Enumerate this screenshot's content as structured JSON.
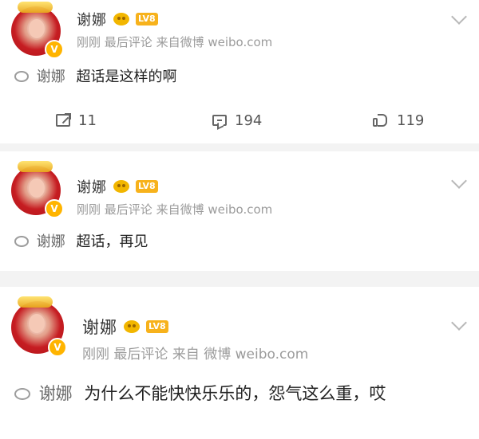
{
  "feed": {
    "posts": [
      {
        "username": "谢娜",
        "level": "LV8",
        "time": "刚刚",
        "last_comment": "最后评论",
        "source": "来自微博 weibo.com",
        "topic": "谢娜",
        "text": "超话是这样的啊",
        "repost_count": "11",
        "comment_count": "194",
        "like_count": "119"
      },
      {
        "username": "谢娜",
        "level": "LV8",
        "time": "刚刚",
        "last_comment": "最后评论",
        "source": "来自微博 weibo.com",
        "topic": "谢娜",
        "text": "超话，再见"
      },
      {
        "username": "谢娜",
        "level": "LV8",
        "time": "刚刚",
        "last_comment": "最后评论",
        "source": "来自 微博 weibo.com",
        "topic": "谢娜",
        "text": "为什么不能快快乐乐的，怨气这么重，哎"
      }
    ]
  },
  "icons": {
    "verified": "verified-badge-icon",
    "emoji": "emoji-badge-icon",
    "level": "level-badge-icon",
    "topic": "topic-icon",
    "menu": "chevron-down-icon",
    "repost": "repost-icon",
    "comment": "comment-icon",
    "like": "like-icon"
  },
  "colors": {
    "background": "#f3f3f3",
    "card": "#ffffff",
    "text": "#222222",
    "secondary_text": "#9b9b9b",
    "topic_text": "#6a6a6a",
    "accent_yellow": "#f7b21c",
    "avatar_red": "#c61d22"
  }
}
